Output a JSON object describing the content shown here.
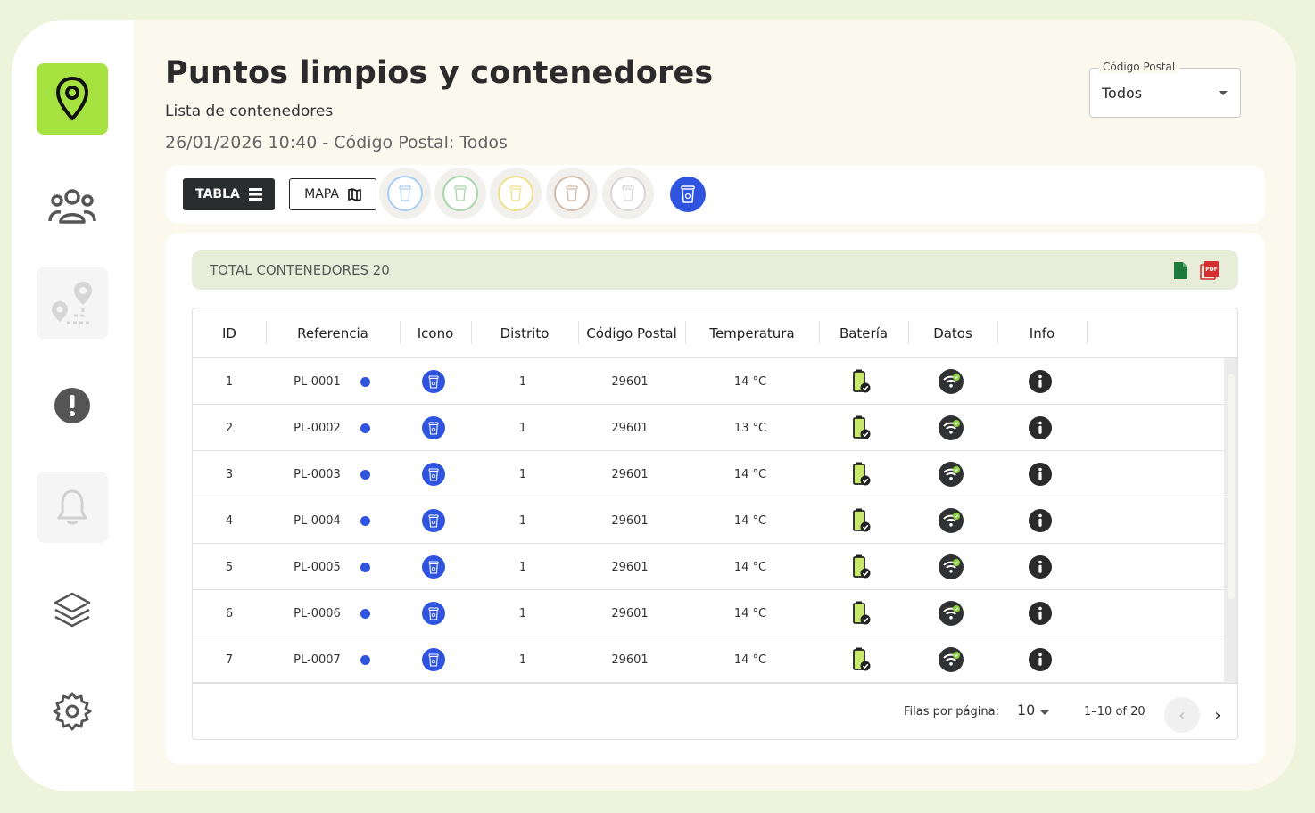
{
  "header": {
    "title": "Puntos limpios y contenedores",
    "subtitle": "Lista de contenedores",
    "datetime": "26/01/2026 10:40 - Código Postal: Todos"
  },
  "postal_select": {
    "label": "Código Postal",
    "value": "Todos"
  },
  "sidebar": {
    "items": [
      {
        "name": "location-pin-icon",
        "state": "active"
      },
      {
        "name": "users-group-icon",
        "state": "normal"
      },
      {
        "name": "route-map-icon",
        "state": "disabled"
      },
      {
        "name": "alert-icon",
        "state": "normal"
      },
      {
        "name": "bell-icon",
        "state": "disabled"
      },
      {
        "name": "layers-icon",
        "state": "normal"
      },
      {
        "name": "settings-icon",
        "state": "normal"
      }
    ]
  },
  "toolbar": {
    "tabla_label": "TABLA",
    "mapa_label": "MAPA",
    "filters": [
      {
        "name": "filter-blue-bin",
        "color": "#a9cdf2"
      },
      {
        "name": "filter-green-bin",
        "color": "#a8d5a8"
      },
      {
        "name": "filter-yellow-bin",
        "color": "#f0e08a"
      },
      {
        "name": "filter-brown-bin",
        "color": "#d2bba8"
      },
      {
        "name": "filter-grey-bin",
        "color": "#d6d6d6"
      },
      {
        "name": "filter-all-bins",
        "color": "#2f54e0"
      }
    ]
  },
  "summary": {
    "total_label": "TOTAL CONTENEDORES 20"
  },
  "table": {
    "columns": [
      "ID",
      "Referencia",
      "Icono",
      "Distrito",
      "Código Postal",
      "Temperatura",
      "Batería",
      "Datos",
      "Info"
    ],
    "rows": [
      {
        "id": "1",
        "ref": "PL-0001",
        "distrito": "1",
        "cp": "29601",
        "temp": "14 °C"
      },
      {
        "id": "2",
        "ref": "PL-0002",
        "distrito": "1",
        "cp": "29601",
        "temp": "13 °C"
      },
      {
        "id": "3",
        "ref": "PL-0003",
        "distrito": "1",
        "cp": "29601",
        "temp": "14 °C"
      },
      {
        "id": "4",
        "ref": "PL-0004",
        "distrito": "1",
        "cp": "29601",
        "temp": "14 °C"
      },
      {
        "id": "5",
        "ref": "PL-0005",
        "distrito": "1",
        "cp": "29601",
        "temp": "14 °C"
      },
      {
        "id": "6",
        "ref": "PL-0006",
        "distrito": "1",
        "cp": "29601",
        "temp": "14 °C"
      },
      {
        "id": "7",
        "ref": "PL-0007",
        "distrito": "1",
        "cp": "29601",
        "temp": "14 °C"
      }
    ]
  },
  "pagination": {
    "rows_per_page_label": "Filas por página:",
    "rows_per_page": "10",
    "range": "1–10 of 20"
  },
  "colors": {
    "accent": "#a6e341",
    "brand_blue": "#2f54e0",
    "dark": "#2a2d2e"
  }
}
